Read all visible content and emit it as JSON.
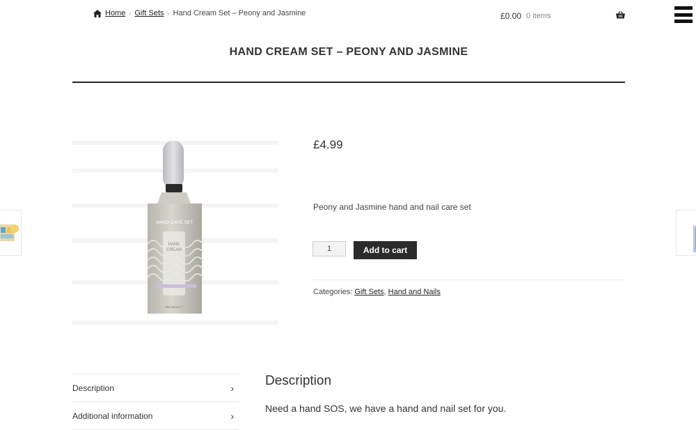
{
  "breadcrumb": {
    "home": "Home",
    "category": "Gift Sets",
    "current": "Hand Cream Set – Peony and Jasmine"
  },
  "cart": {
    "total": "£0.00",
    "count": "0 items"
  },
  "product": {
    "title": "HAND CREAM SET – PEONY AND JASMINE",
    "price": "£4.99",
    "short_description": "Peony and Jasmine hand and nail care set",
    "quantity": "1",
    "add_to_cart": "Add to cart",
    "categories_label": "Categories:",
    "categories": [
      "Gift Sets",
      "Hand and Nails"
    ],
    "image_text": {
      "box_label": "HAND CARE SET",
      "tube_label_1": "HAND",
      "tube_label_2": "CREAM",
      "brand": "PMS BEAUTY"
    }
  },
  "tabs": [
    "Description",
    "Additional information"
  ],
  "description": {
    "heading": "Description",
    "text": "Need a hand SOS, we have a hand and nail set for you."
  },
  "colors": {
    "button_bg": "#2b2b2b",
    "title_rule": "#222222",
    "packaging_silver": "#c9c6c0"
  },
  "icons": {
    "home": "home-icon",
    "basket": "basket-icon",
    "menu": "hamburger-menu-icon",
    "chevron": "chevron-right-icon"
  }
}
